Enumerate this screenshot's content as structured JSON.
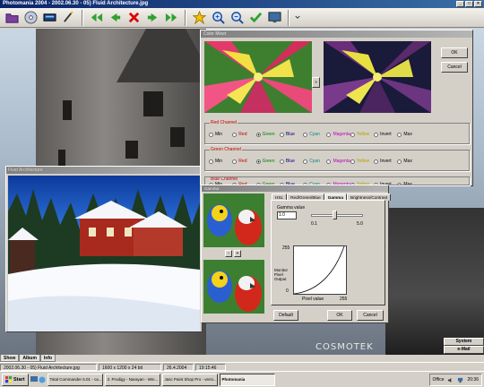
{
  "window": {
    "title": "Photomania 2004 - 2002.06.30 - 05) Fluid Architecture.jpg",
    "controls": [
      "_",
      "□",
      "×"
    ]
  },
  "toolbar": {
    "buttons": [
      "open-folder",
      "cd",
      "scanner",
      "wand",
      "first",
      "prev",
      "delete",
      "next",
      "last",
      "favorite",
      "zoom-in",
      "zoom-out",
      "apply",
      "monitor"
    ]
  },
  "photo_window": {
    "title": "Fluid Architecture"
  },
  "color_mixer": {
    "title": "Color Mixer",
    "ok_label": "OK",
    "cancel_label": "Cancel",
    "arrow_label": "»",
    "channels": [
      {
        "label": "Red Channel",
        "selected": 2
      },
      {
        "label": "Green Channel",
        "selected": 2
      },
      {
        "label": "Blue Channel",
        "selected": 6
      }
    ],
    "options": [
      "Min",
      "Red",
      "Green",
      "Blue",
      "Cyan",
      "Magenta",
      "Yellow",
      "Invert",
      "Max"
    ],
    "option_colors": [
      "#000000",
      "#c00000",
      "#008000",
      "#000080",
      "#008080",
      "#c000c0",
      "#b0a000",
      "#000000",
      "#000000"
    ]
  },
  "gamma_dialog": {
    "title": "Gamma",
    "tabs": [
      "HSL",
      "Red/Green/Blue",
      "Gamma",
      "Brightness/Contrast"
    ],
    "active_tab": 2,
    "gamma_label": "Gamma value",
    "gamma_value": "1.0",
    "slider_min": "0.1",
    "slider_max": "5.0",
    "plot_top": "255",
    "plot_y_label": [
      "Monitor",
      "Pixel",
      "Output"
    ],
    "plot_zero": "0",
    "plot_x_label": "Pixel value",
    "plot_x_max": "255",
    "default_label": "Default",
    "ok_label": "OK",
    "cancel_label": "Cancel"
  },
  "bottom_tabs": [
    "Show",
    "Album",
    "Info"
  ],
  "status": {
    "file": "2002.06.30 - 05) Fluid Architecture.jpg",
    "dimensions": "1600 x 1200 x 24 bit",
    "date": "26.4.2004",
    "time": "19:15:46"
  },
  "side_buttons": [
    "System",
    "e-Mail"
  ],
  "brand": "COSMOTEK",
  "taskbar": {
    "start": "Start",
    "items": [
      {
        "label": "Total Commander 6.01 - ca...",
        "active": false
      },
      {
        "label": "3. Prodigy - Narayan - Win...",
        "active": false
      },
      {
        "label": "Jasc Paint Shop Pro - versi...",
        "active": false
      },
      {
        "label": "Photomania",
        "active": true
      }
    ],
    "tray_office": "Office",
    "clock": "20:36"
  }
}
